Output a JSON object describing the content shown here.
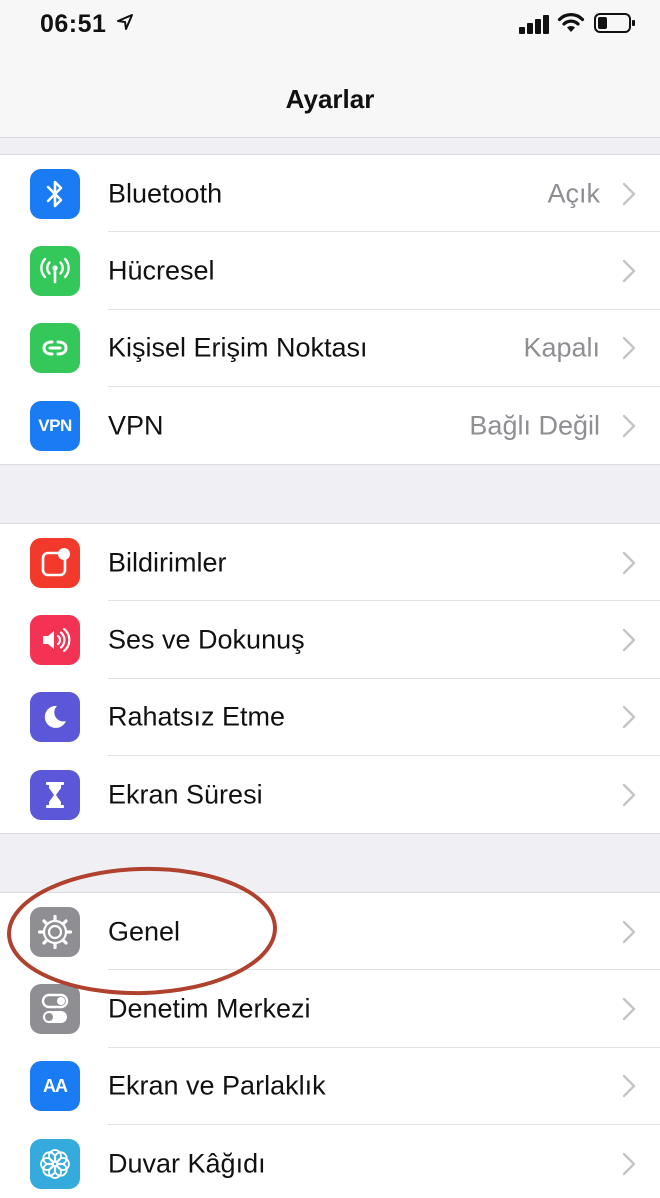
{
  "status_bar": {
    "time": "06:51",
    "icons": [
      "location-arrow-icon",
      "cellular-signal-icon",
      "wifi-icon",
      "battery-icon"
    ]
  },
  "nav": {
    "title": "Ayarlar"
  },
  "groups": [
    {
      "rows": [
        {
          "label": "Bluetooth",
          "value": "Açık",
          "icon": "bluetooth-icon",
          "color": "#1a7cf5"
        },
        {
          "label": "Hücresel",
          "value": "",
          "icon": "cellular-antenna-icon",
          "color": "#34c759"
        },
        {
          "label": "Kişisel Erişim Noktası",
          "value": "Kapalı",
          "icon": "personal-hotspot-icon",
          "color": "#34c759"
        },
        {
          "label": "VPN",
          "value": "Bağlı Değil",
          "icon": "vpn-icon",
          "icon_text": "VPN",
          "color": "#1a7cf5"
        }
      ]
    },
    {
      "rows": [
        {
          "label": "Bildirimler",
          "value": "",
          "icon": "notifications-icon",
          "color": "#f2392c"
        },
        {
          "label": "Ses ve Dokunuş",
          "value": "",
          "icon": "speaker-icon",
          "color": "#f43254"
        },
        {
          "label": "Rahatsız Etme",
          "value": "",
          "icon": "moon-icon",
          "color": "#5b57d8"
        },
        {
          "label": "Ekran Süresi",
          "value": "",
          "icon": "hourglass-icon",
          "color": "#5b57d8"
        }
      ]
    },
    {
      "rows": [
        {
          "label": "Genel",
          "value": "",
          "icon": "gear-icon",
          "color": "#8e8e93"
        },
        {
          "label": "Denetim Merkezi",
          "value": "",
          "icon": "control-center-icon",
          "color": "#8e8e93"
        },
        {
          "label": "Ekran ve Parlaklık",
          "value": "",
          "icon": "display-brightness-icon",
          "icon_text": "AA",
          "color": "#1a7cf5"
        },
        {
          "label": "Duvar Kâğıdı",
          "value": "",
          "icon": "wallpaper-flower-icon",
          "color": "#35aadc"
        }
      ]
    }
  ],
  "annotation": {
    "highlight_color": "#b0412e"
  }
}
